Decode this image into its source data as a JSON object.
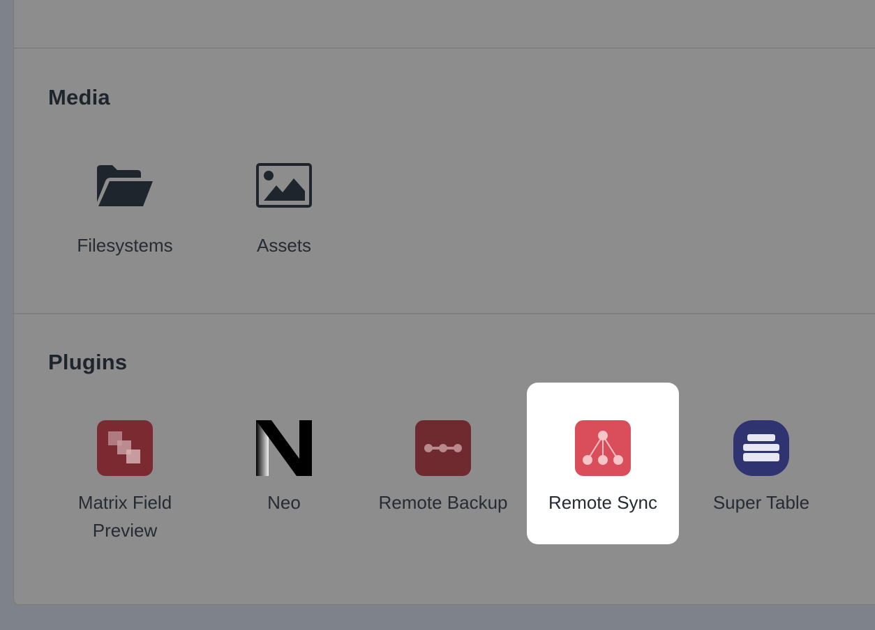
{
  "sections": {
    "media": {
      "title": "Media",
      "items": [
        {
          "label": "Filesystems",
          "icon": "folder-open-icon"
        },
        {
          "label": "Assets",
          "icon": "image-icon"
        }
      ]
    },
    "plugins": {
      "title": "Plugins",
      "items": [
        {
          "label": "Matrix Field Preview",
          "icon": "matrix-field-preview-icon"
        },
        {
          "label": "Neo",
          "icon": "neo-logo-icon"
        },
        {
          "label": "Remote Backup",
          "icon": "remote-backup-icon"
        },
        {
          "label": "Remote Sync",
          "icon": "remote-sync-icon",
          "selected": true
        },
        {
          "label": "Super Table",
          "icon": "super-table-icon"
        }
      ]
    }
  },
  "colors": {
    "page_background": "#7e828a",
    "panel_background": "#8d8d8d",
    "heading_text": "#1e252d",
    "label_text": "#262c33",
    "selected_tile": "#ffffff",
    "matrix_red": "#7b2a31",
    "remote_backup_red": "#6f2a30",
    "remote_sync_red": "#d94e5a",
    "super_table_navy": "#2f3370"
  }
}
